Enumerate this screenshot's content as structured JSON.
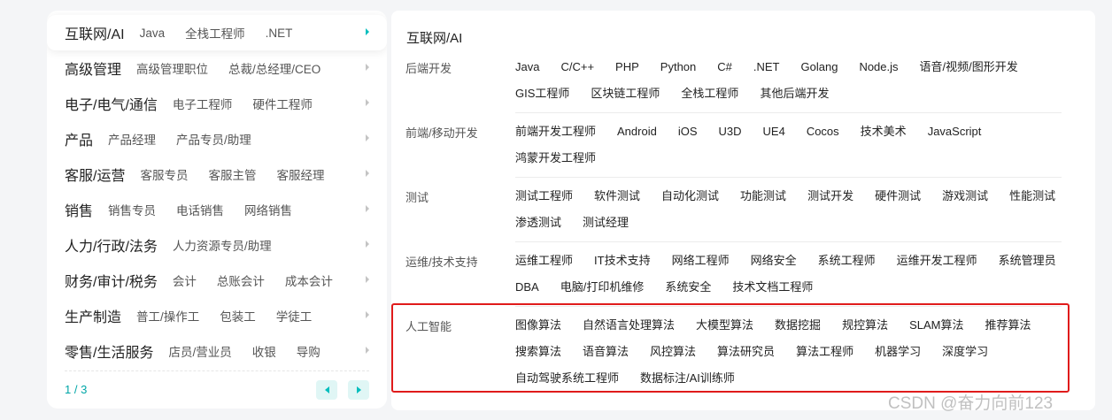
{
  "left_panel": {
    "categories": [
      {
        "name": "互联网/AI",
        "subs": [
          "Java",
          "全栈工程师",
          ".NET"
        ]
      },
      {
        "name": "高级管理",
        "subs": [
          "高级管理职位",
          "总裁/总经理/CEO"
        ]
      },
      {
        "name": "电子/电气/通信",
        "subs": [
          "电子工程师",
          "硬件工程师"
        ]
      },
      {
        "name": "产品",
        "subs": [
          "产品经理",
          "产品专员/助理"
        ]
      },
      {
        "name": "客服/运营",
        "subs": [
          "客服专员",
          "客服主管",
          "客服经理"
        ]
      },
      {
        "name": "销售",
        "subs": [
          "销售专员",
          "电话销售",
          "网络销售"
        ]
      },
      {
        "name": "人力/行政/法务",
        "subs": [
          "人力资源专员/助理"
        ]
      },
      {
        "name": "财务/审计/税务",
        "subs": [
          "会计",
          "总账会计",
          "成本会计"
        ]
      },
      {
        "name": "生产制造",
        "subs": [
          "普工/操作工",
          "包装工",
          "学徒工"
        ]
      },
      {
        "name": "零售/生活服务",
        "subs": [
          "店员/营业员",
          "收银",
          "导购"
        ]
      }
    ],
    "pagination": {
      "indicator": "1 / 3"
    }
  },
  "right_panel": {
    "title": "互联网/AI",
    "sections": [
      {
        "label": "后端开发",
        "lines": [
          [
            "Java",
            "C/C++",
            "PHP",
            "Python",
            "C#",
            ".NET",
            "Golang",
            "Node.js",
            "语音/视频/图形开发"
          ],
          [
            "GIS工程师",
            "区块链工程师",
            "全栈工程师",
            "其他后端开发"
          ]
        ]
      },
      {
        "label": "前端/移动开发",
        "lines": [
          [
            "前端开发工程师",
            "Android",
            "iOS",
            "U3D",
            "UE4",
            "Cocos",
            "技术美术",
            "JavaScript"
          ],
          [
            "鸿蒙开发工程师"
          ]
        ]
      },
      {
        "label": "测试",
        "lines": [
          [
            "测试工程师",
            "软件测试",
            "自动化测试",
            "功能测试",
            "测试开发",
            "硬件测试",
            "游戏测试",
            "性能测试"
          ],
          [
            "渗透测试",
            "测试经理"
          ]
        ]
      },
      {
        "label": "运维/技术支持",
        "lines": [
          [
            "运维工程师",
            "IT技术支持",
            "网络工程师",
            "网络安全",
            "系统工程师",
            "运维开发工程师",
            "系统管理员"
          ],
          [
            "DBA",
            "电脑/打印机维修",
            "系统安全",
            "技术文档工程师"
          ]
        ]
      },
      {
        "label": "人工智能",
        "lines": [
          [
            "图像算法",
            "自然语言处理算法",
            "大模型算法",
            "数据挖掘",
            "规控算法",
            "SLAM算法",
            "推荐算法"
          ],
          [
            "搜索算法",
            "语音算法",
            "风控算法",
            "算法研究员",
            "算法工程师",
            "机器学习",
            "深度学习"
          ],
          [
            "自动驾驶系统工程师",
            "数据标注/AI训练师"
          ]
        ]
      }
    ]
  },
  "watermark": "CSDN @奋力向前123",
  "colors": {
    "accent": "#00bebd",
    "highlight": "#e01b1b"
  }
}
